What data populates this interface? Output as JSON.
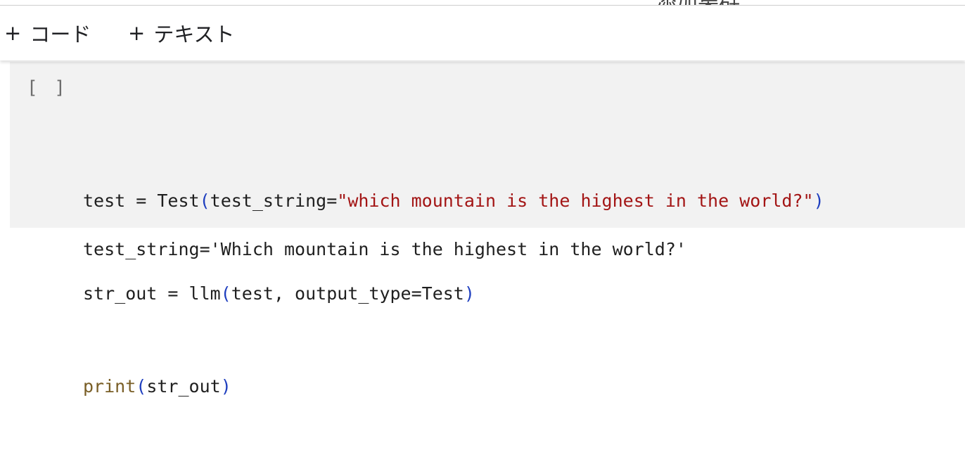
{
  "toolbar": {
    "add_code": {
      "plus": "+",
      "label": "コード"
    },
    "add_text": {
      "plus": "+",
      "label": "テキスト"
    },
    "clipped_header_text": "添加集群"
  },
  "cell": {
    "run_indicator": "[ ]",
    "code_lines": [
      {
        "l1_a": "test = Test",
        "l1_p1": "(",
        "l1_b": "test_string=",
        "l1_str": "\"which mountain is the highest in the world?\"",
        "l1_p2": ")"
      },
      {
        "l2_a": "str_out = llm",
        "l2_p1": "(",
        "l2_b": "test, output_type=Test",
        "l2_p2": ")"
      },
      {
        "l3_fn": "print",
        "l3_p1": "(",
        "l3_b": "str_out",
        "l3_p2": ")"
      }
    ],
    "output": "test_string='Which mountain is the highest in the world?'"
  },
  "colors": {
    "string": "#a31515",
    "paren": "#1f3fbf",
    "builtin_fn": "#795e26",
    "cell_bg": "#f2f2f2"
  }
}
